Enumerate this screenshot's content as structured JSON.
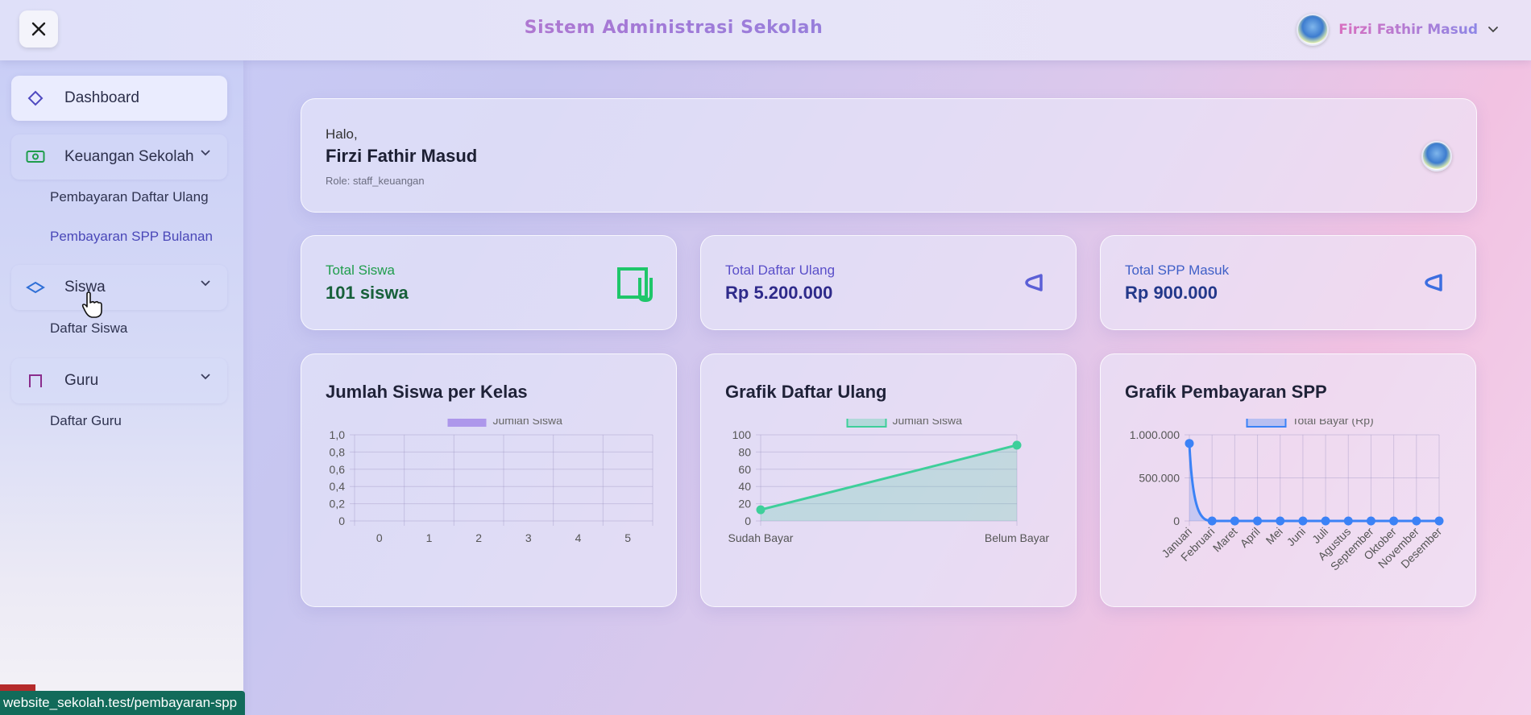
{
  "header": {
    "close_icon": "close-icon",
    "app_title": "Sistem Administrasi Sekolah",
    "user_name": "Firzi Fathir Masud",
    "dropdown_icon": "chevron-down-icon"
  },
  "sidebar": {
    "dashboard": {
      "label": "Dashboard",
      "icon": "diamond-icon"
    },
    "keuangan": {
      "label": "Keuangan Sekolah",
      "icon": "money-icon",
      "items": [
        "Pembayaran Daftar Ulang",
        "Pembayaran SPP Bulanan"
      ]
    },
    "siswa": {
      "label": "Siswa",
      "icon": "layers-icon",
      "items": [
        "Daftar Siswa"
      ]
    },
    "guru": {
      "label": "Guru",
      "icon": "bookmark-icon",
      "items": [
        "Daftar Guru"
      ]
    }
  },
  "status_bar": {
    "url": "website_sekolah.test/pembayaran-spp"
  },
  "greeting": {
    "hello": "Halo,",
    "name": "Firzi Fathir Masud",
    "role": "Role: staff_keuangan"
  },
  "stats": [
    {
      "label": "Total Siswa",
      "value": "101 siswa",
      "color": "#1f9d4c",
      "value_color": "#17603a",
      "icon": "students-icon"
    },
    {
      "label": "Total Daftar Ulang",
      "value": "Rp 5.200.000",
      "color": "#5a4fc9",
      "value_color": "#2e2a8a",
      "icon": "tag-icon"
    },
    {
      "label": "Total SPP Masuk",
      "value": "Rp 900.000",
      "color": "#3f5fc7",
      "value_color": "#23388a",
      "icon": "tag-icon"
    }
  ],
  "chart_data": [
    {
      "type": "bar",
      "title": "Jumlah Siswa per Kelas",
      "legend": "Jumlah Siswa",
      "categories": [
        "0",
        "1",
        "2",
        "3",
        "4",
        "5"
      ],
      "values": [
        0,
        0,
        0,
        0,
        0,
        0
      ],
      "yticks": [
        "1,0",
        "0,8",
        "0,6",
        "0,4",
        "0,2",
        "0"
      ],
      "ylim": [
        0,
        1
      ],
      "color": "#a58be9",
      "grid": true,
      "legend_position": "top"
    },
    {
      "type": "line",
      "title": "Grafik Daftar Ulang",
      "legend": "Jumlah Siswa",
      "categories": [
        "Sudah Bayar",
        "Belum Bayar"
      ],
      "values": [
        13,
        88
      ],
      "yticks": [
        "100",
        "80",
        "60",
        "40",
        "20",
        "0"
      ],
      "ylim": [
        0,
        100
      ],
      "color": "#3ecf9a",
      "grid": true,
      "legend_position": "top"
    },
    {
      "type": "line",
      "title": "Grafik Pembayaran SPP",
      "legend": "Total Bayar (Rp)",
      "categories": [
        "Januari",
        "Februari",
        "Maret",
        "April",
        "Mei",
        "Juni",
        "Juli",
        "Agustus",
        "September",
        "Oktober",
        "November",
        "Desember"
      ],
      "values": [
        900000,
        0,
        0,
        0,
        0,
        0,
        0,
        0,
        0,
        0,
        0,
        0
      ],
      "yticks": [
        "1.000.000",
        "500.000",
        "0"
      ],
      "ylim": [
        0,
        1000000
      ],
      "color": "#3b82f6",
      "grid": true,
      "legend_position": "top"
    }
  ]
}
